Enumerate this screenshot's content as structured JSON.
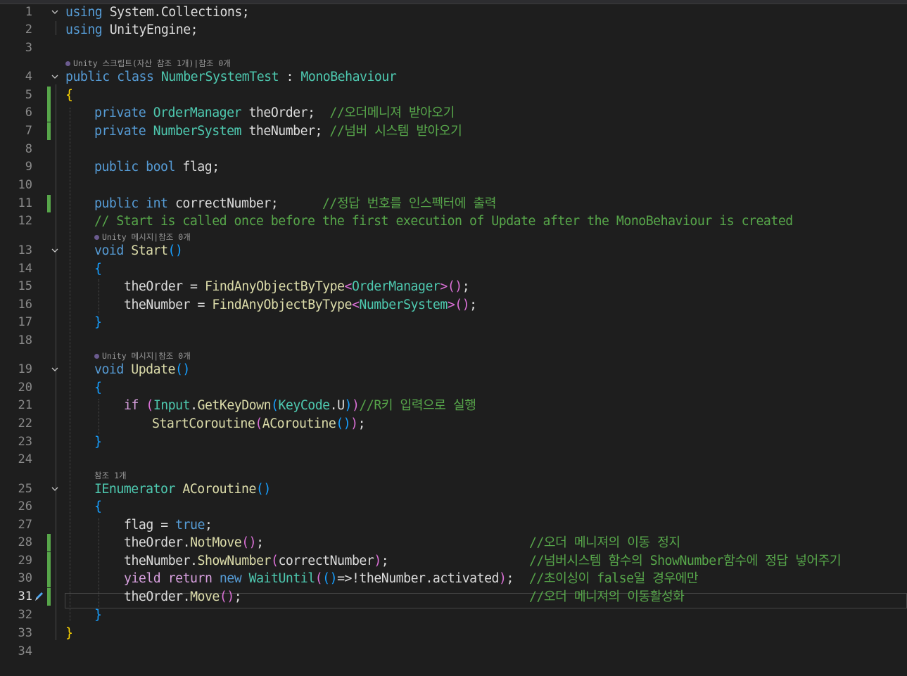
{
  "editor": {
    "current_line": "31",
    "line_numbers": [
      "1",
      "2",
      "3",
      "4",
      "5",
      "6",
      "7",
      "8",
      "9",
      "10",
      "11",
      "12",
      "13",
      "14",
      "15",
      "16",
      "17",
      "18",
      "19",
      "20",
      "21",
      "22",
      "23",
      "24",
      "25",
      "26",
      "27",
      "28",
      "29",
      "30",
      "31",
      "32",
      "33",
      "34"
    ],
    "codelens": {
      "class_refs": "Unity 스크립트(자산 참조 1개)|참조 0개",
      "start_refs": "Unity 메시지|참조 0개",
      "update_refs": "Unity 메시지|참조 0개",
      "coroutine_refs": "참조 1개"
    },
    "code": {
      "l1_kw": "using",
      "l1_rest": " System.Collections;",
      "l2_kw": "using",
      "l2_rest": " UnityEngine;",
      "l4_kw": "public class",
      "l4_name": "NumberSystemTest",
      "l4_colon": " : ",
      "l4_base": "MonoBehaviour",
      "l5": "{",
      "l6_kw": "private",
      "l6_type": "OrderManager",
      "l6_var": " theOrder;  ",
      "l6_cmt": "//오더메니져 받아오기",
      "l7_kw": "private",
      "l7_type": "NumberSystem",
      "l7_var": " theNumber; ",
      "l7_cmt": "//넘버 시스템 받아오기",
      "l9_kw": "public bool",
      "l9_rest": " flag;",
      "l11_kw": "public int",
      "l11_rest": " correctNumber;      ",
      "l11_cmt": "//정답 번호를 인스펙터에 출력",
      "l12_cmt": "// Start is called once before the first execution of Update after the MonoBehaviour is created",
      "l13_kw": "void",
      "l13_name": "Start",
      "l13_paren": "()",
      "l14": "{",
      "l15_var": "theOrder = ",
      "l15_m": "FindAnyObjectByType",
      "l15_lt": "<",
      "l15_t": "OrderManager",
      "l15_gt": ">",
      "l15_paren": "()",
      "l15_end": ";",
      "l16_var": "theNumber = ",
      "l16_m": "FindAnyObjectByType",
      "l16_lt": "<",
      "l16_t": "NumberSystem",
      "l16_gt": ">",
      "l16_paren": "()",
      "l16_end": ";",
      "l17": "}",
      "l19_kw": "void",
      "l19_name": "Update",
      "l19_paren": "()",
      "l20": "{",
      "l21_if": "if",
      "l21_sp": " ",
      "l21_p1": "(",
      "l21_input": "Input",
      "l21_dot": ".",
      "l21_m": "GetKeyDown",
      "l21_p2": "(",
      "l21_kc": "KeyCode",
      "l21_u": ".U",
      "l21_p3": ")",
      "l21_p4": ")",
      "l21_cmt": "//R키 입력으로 실행",
      "l22_m": "StartCoroutine",
      "l22_p1": "(",
      "l22_m2": "ACoroutine",
      "l22_p2": "()",
      "l22_p3": ")",
      "l22_end": ";",
      "l23": "}",
      "l25_type": "IEnumerator",
      "l25_name": " ACoroutine",
      "l25_paren": "()",
      "l26": "{",
      "l27_var": "flag = ",
      "l27_kw": "true",
      "l27_end": ";",
      "l28_var": "theOrder.",
      "l28_m": "NotMove",
      "l28_paren": "()",
      "l28_end": ";",
      "l28_cmt": "//오더 메니져의 이동 정지",
      "l29_var": "theNumber.",
      "l29_m": "ShowNumber",
      "l29_p1": "(",
      "l29_arg": "correctNumber",
      "l29_p2": ")",
      "l29_end": ";",
      "l29_cmt": "//넘버시스템 함수의 ShowNumber함수에 정답 넣어주기",
      "l30_kw": "yield return",
      "l30_new": " new ",
      "l30_t": "WaitUntil",
      "l30_p1": "(",
      "l30_p2": "()",
      "l30_arrow": "=>!theNumber.activated",
      "l30_p3": ")",
      "l30_end": ";",
      "l30_cmt": "//초이싱이 false일 경우에만",
      "l31_var": "theOrder.",
      "l31_m": "Move",
      "l31_paren": "()",
      "l31_end": ";",
      "l31_cmt": "//오더 메니져의 이동활성화",
      "l32": "}",
      "l33": "}"
    }
  }
}
